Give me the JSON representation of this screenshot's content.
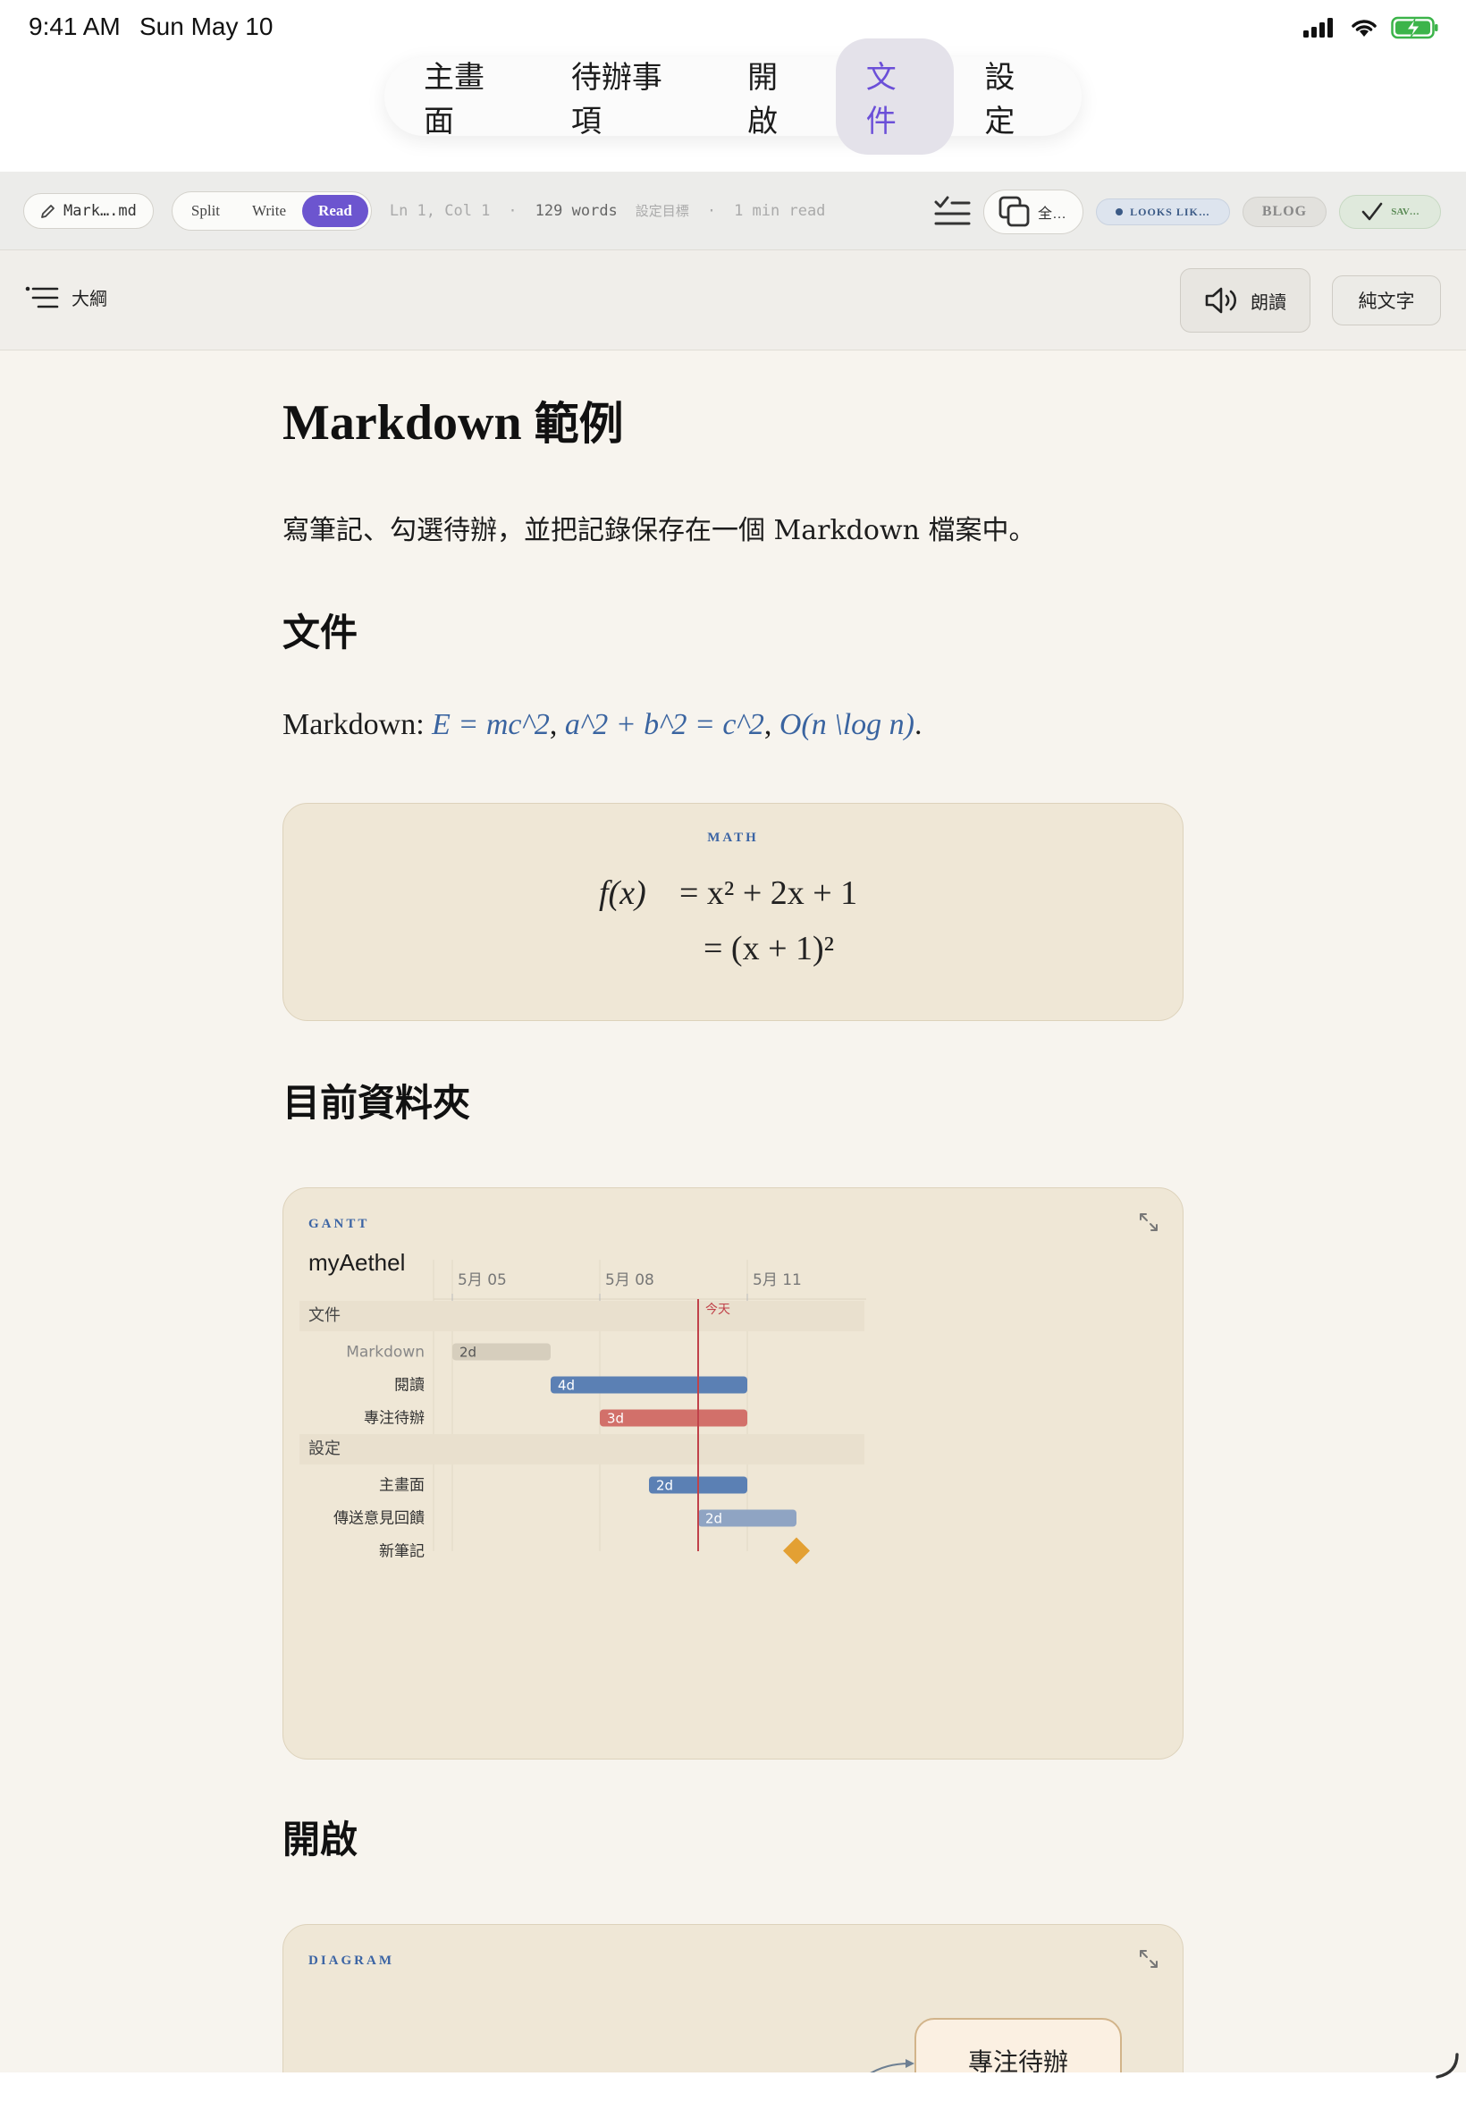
{
  "status_bar": {
    "time": "9:41 AM",
    "date": "Sun May 10"
  },
  "nav": {
    "tabs": [
      {
        "label": "主畫面",
        "active": false
      },
      {
        "label": "待辦事項",
        "active": false
      },
      {
        "label": "開啟",
        "active": false
      },
      {
        "label": "文件",
        "active": true
      },
      {
        "label": "設定",
        "active": false
      }
    ]
  },
  "toolbar": {
    "file_name": "Mark….md",
    "modes": [
      "Split",
      "Write",
      "Read"
    ],
    "active_mode": "Read",
    "cursor": "Ln 1, Col 1",
    "sep1": "·",
    "words": "129 words",
    "goal": "設定目標",
    "sep2": "·",
    "read_time": "1 min read",
    "copy_label": "全…",
    "looks_label": "LOOKS LIK…",
    "blog_label": "BLOG",
    "save_label": "SAV…"
  },
  "outline_bar": {
    "outline_label": "大綱",
    "read_aloud_label": "朗讀",
    "plain_text_label": "純文字"
  },
  "document": {
    "title_latin": "Markdown ",
    "title_cjk": "範例",
    "intro": "寫筆記、勾選待辦，並把記錄保存在一個 Markdown 檔案中。",
    "h2_file": "文件",
    "math_prefix": "Markdown: ",
    "math_inline_1": "E = mc^2",
    "math_inline_2": "a^2 + b^2 = c^2",
    "math_inline_3": "O(n \\log n)",
    "comma": ", ",
    "period": ".",
    "math_card": {
      "label": "MATH",
      "lhs": "f(x)",
      "rhs1": "= x² + 2x + 1",
      "rhs2": "= (x + 1)²"
    },
    "h2_folder": "目前資料夾",
    "h2_open": "開啟",
    "diagram_card": {
      "label": "DIAGRAM",
      "node_label": "專注待辦"
    }
  },
  "gantt": {
    "label": "GANTT",
    "title": "myAethel",
    "dates": [
      "5月 05",
      "5月 08",
      "5月 11"
    ],
    "today_label": "今天",
    "today_day": 10.0,
    "start_day": 4.8,
    "sections": [
      {
        "name": "文件",
        "tasks": [
          {
            "name": "Markdown",
            "start": 5,
            "duration": 2,
            "label": "2d",
            "style": "done"
          },
          {
            "name": "閱讀",
            "start": 7,
            "duration": 4,
            "label": "4d",
            "style": "active"
          },
          {
            "name": "專注待辦",
            "start": 8,
            "duration": 3,
            "label": "3d",
            "style": "crit"
          }
        ]
      },
      {
        "name": "設定",
        "tasks": [
          {
            "name": "主畫面",
            "start": 9,
            "duration": 2,
            "label": "2d",
            "style": "active"
          },
          {
            "name": "傳送意見回饋",
            "start": 10,
            "duration": 2,
            "label": "2d",
            "style": "future"
          },
          {
            "name": "新筆記",
            "start": 12,
            "duration": 0,
            "label": "",
            "style": "milestone"
          }
        ]
      }
    ],
    "colors": {
      "done": "#d6cebd",
      "active": "#5b80b4",
      "crit": "#d2706a",
      "future": "#8fa4c3",
      "milestone": "#e3a033",
      "today": "#c0424a"
    }
  }
}
